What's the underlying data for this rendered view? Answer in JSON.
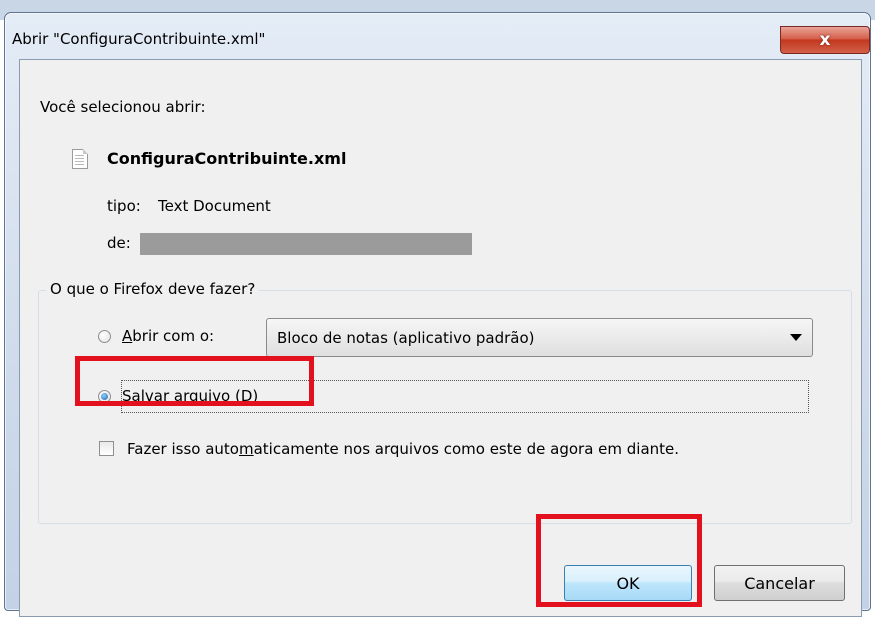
{
  "window": {
    "title": "Abrir \"ConfiguraContribuinte.xml\"",
    "close_glyph": "x"
  },
  "dialog": {
    "intro": "Você selecionou abrir:",
    "file_icon": "text-document-icon",
    "filename": "ConfiguraContribuinte.xml",
    "type_label": "tipo:",
    "type_value": "Text Document",
    "from_label": "de:"
  },
  "action_group": {
    "legend": "O que o Firefox deve fazer?",
    "open_with": {
      "label_prefix": "A",
      "label_rest": "brir com o:",
      "selected": false,
      "app": "Bloco de notas (aplicativo padrão)"
    },
    "save_file": {
      "label_text": "Salvar arquivo (",
      "accesskey": "D",
      "label_end": ")",
      "selected": true
    },
    "auto": {
      "label_before": "Fazer isso auto",
      "accesskey": "m",
      "label_after": "aticamente nos arquivos como este de agora em diante.",
      "checked": false
    }
  },
  "buttons": {
    "ok": "OK",
    "cancel": "Cancelar"
  },
  "colors": {
    "highlight": "#e3101e",
    "accent": "#3c7fb1"
  }
}
